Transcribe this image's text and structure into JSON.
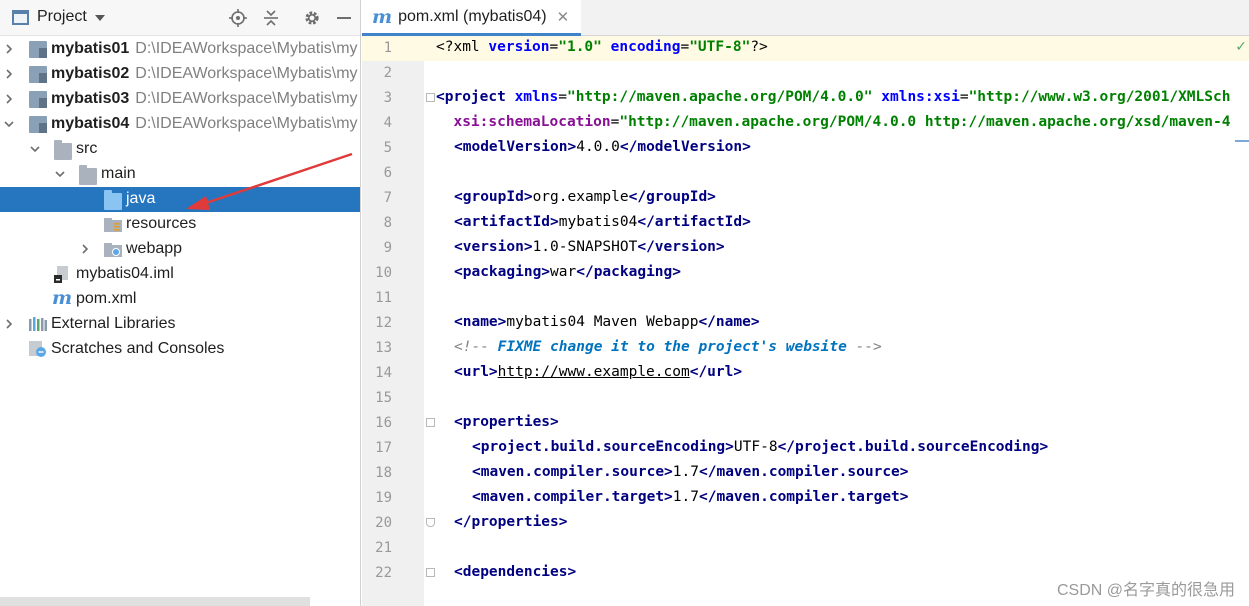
{
  "panel": {
    "title": "Project",
    "header_icons": [
      "locate-icon",
      "collapse-icon",
      "gear-icon",
      "minimize-icon"
    ]
  },
  "tree": [
    {
      "label": "mybatis01",
      "path": "D:\\IDEAWorkspace\\Mybatis\\my",
      "icon": "module-icon",
      "expanded": false
    },
    {
      "label": "mybatis02",
      "path": "D:\\IDEAWorkspace\\Mybatis\\my",
      "icon": "module-icon",
      "expanded": false
    },
    {
      "label": "mybatis03",
      "path": "D:\\IDEAWorkspace\\Mybatis\\my",
      "icon": "module-icon",
      "expanded": false
    },
    {
      "label": "mybatis04",
      "path": "D:\\IDEAWorkspace\\Mybatis\\my",
      "icon": "module-icon",
      "expanded": true
    },
    {
      "label": "src",
      "icon": "folder-icon",
      "expanded": true
    },
    {
      "label": "main",
      "icon": "folder-icon",
      "expanded": true
    },
    {
      "label": "java",
      "icon": "source-folder-icon",
      "selected": true
    },
    {
      "label": "resources",
      "icon": "resources-folder-icon"
    },
    {
      "label": "webapp",
      "icon": "web-folder-icon",
      "expanded": false
    },
    {
      "label": "mybatis04.iml",
      "icon": "iml-file-icon"
    },
    {
      "label": "pom.xml",
      "icon": "maven-file-icon"
    },
    {
      "label": "External Libraries",
      "icon": "libraries-icon",
      "expanded": false
    },
    {
      "label": "Scratches and Consoles",
      "icon": "scratches-icon"
    }
  ],
  "editor": {
    "tab_label": "pom.xml (mybatis04)",
    "line_numbers": [
      "1",
      "2",
      "3",
      "4",
      "5",
      "6",
      "7",
      "8",
      "9",
      "10",
      "11",
      "12",
      "13",
      "14",
      "15",
      "16",
      "17",
      "18",
      "19",
      "20",
      "21",
      "22"
    ],
    "code": {
      "l1_a": "<?xml ",
      "l1_b": "version",
      "l1_c": "=",
      "l1_d": "\"1.0\"",
      "l1_e": " ",
      "l1_f": "encoding",
      "l1_g": "=",
      "l1_h": "\"UTF-8\"",
      "l1_i": "?>",
      "l3_a": "<project ",
      "l3_b": "xmlns",
      "l3_c": "=",
      "l3_d": "\"http://maven.apache.org/POM/4.0.0\"",
      "l3_e": " ",
      "l3_f": "xmlns:xsi",
      "l3_g": "=",
      "l3_h": "\"http://www.w3.org/2001/XMLSch",
      "l4_a": "  ",
      "l4_b": "xsi:schemaLocation",
      "l4_c": "=",
      "l4_d": "\"http://maven.apache.org/POM/4.0.0 http://maven.apache.org/xsd/maven-4",
      "l5_a": "<modelVersion>",
      "l5_b": "4.0.0",
      "l5_c": "</modelVersion>",
      "l7_a": "<groupId>",
      "l7_b": "org.example",
      "l7_c": "</groupId>",
      "l8_a": "<artifactId>",
      "l8_b": "mybatis04",
      "l8_c": "</artifactId>",
      "l9_a": "<version>",
      "l9_b": "1.0-SNAPSHOT",
      "l9_c": "</version>",
      "l10_a": "<packaging>",
      "l10_b": "war",
      "l10_c": "</packaging>",
      "l12_a": "<name>",
      "l12_b": "mybatis04 Maven Webapp",
      "l12_c": "</name>",
      "l13_a": "<!-- ",
      "l13_b": "FIXME",
      "l13_c": " change it to the project's website",
      "l13_d": " -->",
      "l14_a": "<url>",
      "l14_b": "http://www.example.com",
      "l14_c": "</url>",
      "l16_a": "<properties>",
      "l17_a": "<project.build.sourceEncoding>",
      "l17_b": "UTF-8",
      "l17_c": "</project.build.sourceEncoding>",
      "l18_a": "<maven.compiler.source>",
      "l18_b": "1.7",
      "l18_c": "</maven.compiler.source>",
      "l19_a": "<maven.compiler.target>",
      "l19_b": "1.7",
      "l19_c": "</maven.compiler.target>",
      "l20_a": "</properties>",
      "l22_a": "<dependencies>"
    }
  },
  "watermark": "CSDN @名字真的很急用",
  "colors": {
    "selection": "#2675bf",
    "tag": "#000080",
    "attr": "#0000ff",
    "value": "#008000",
    "comment": "#808080",
    "current_line": "#fffae3",
    "arrow": "#e03a3a"
  }
}
